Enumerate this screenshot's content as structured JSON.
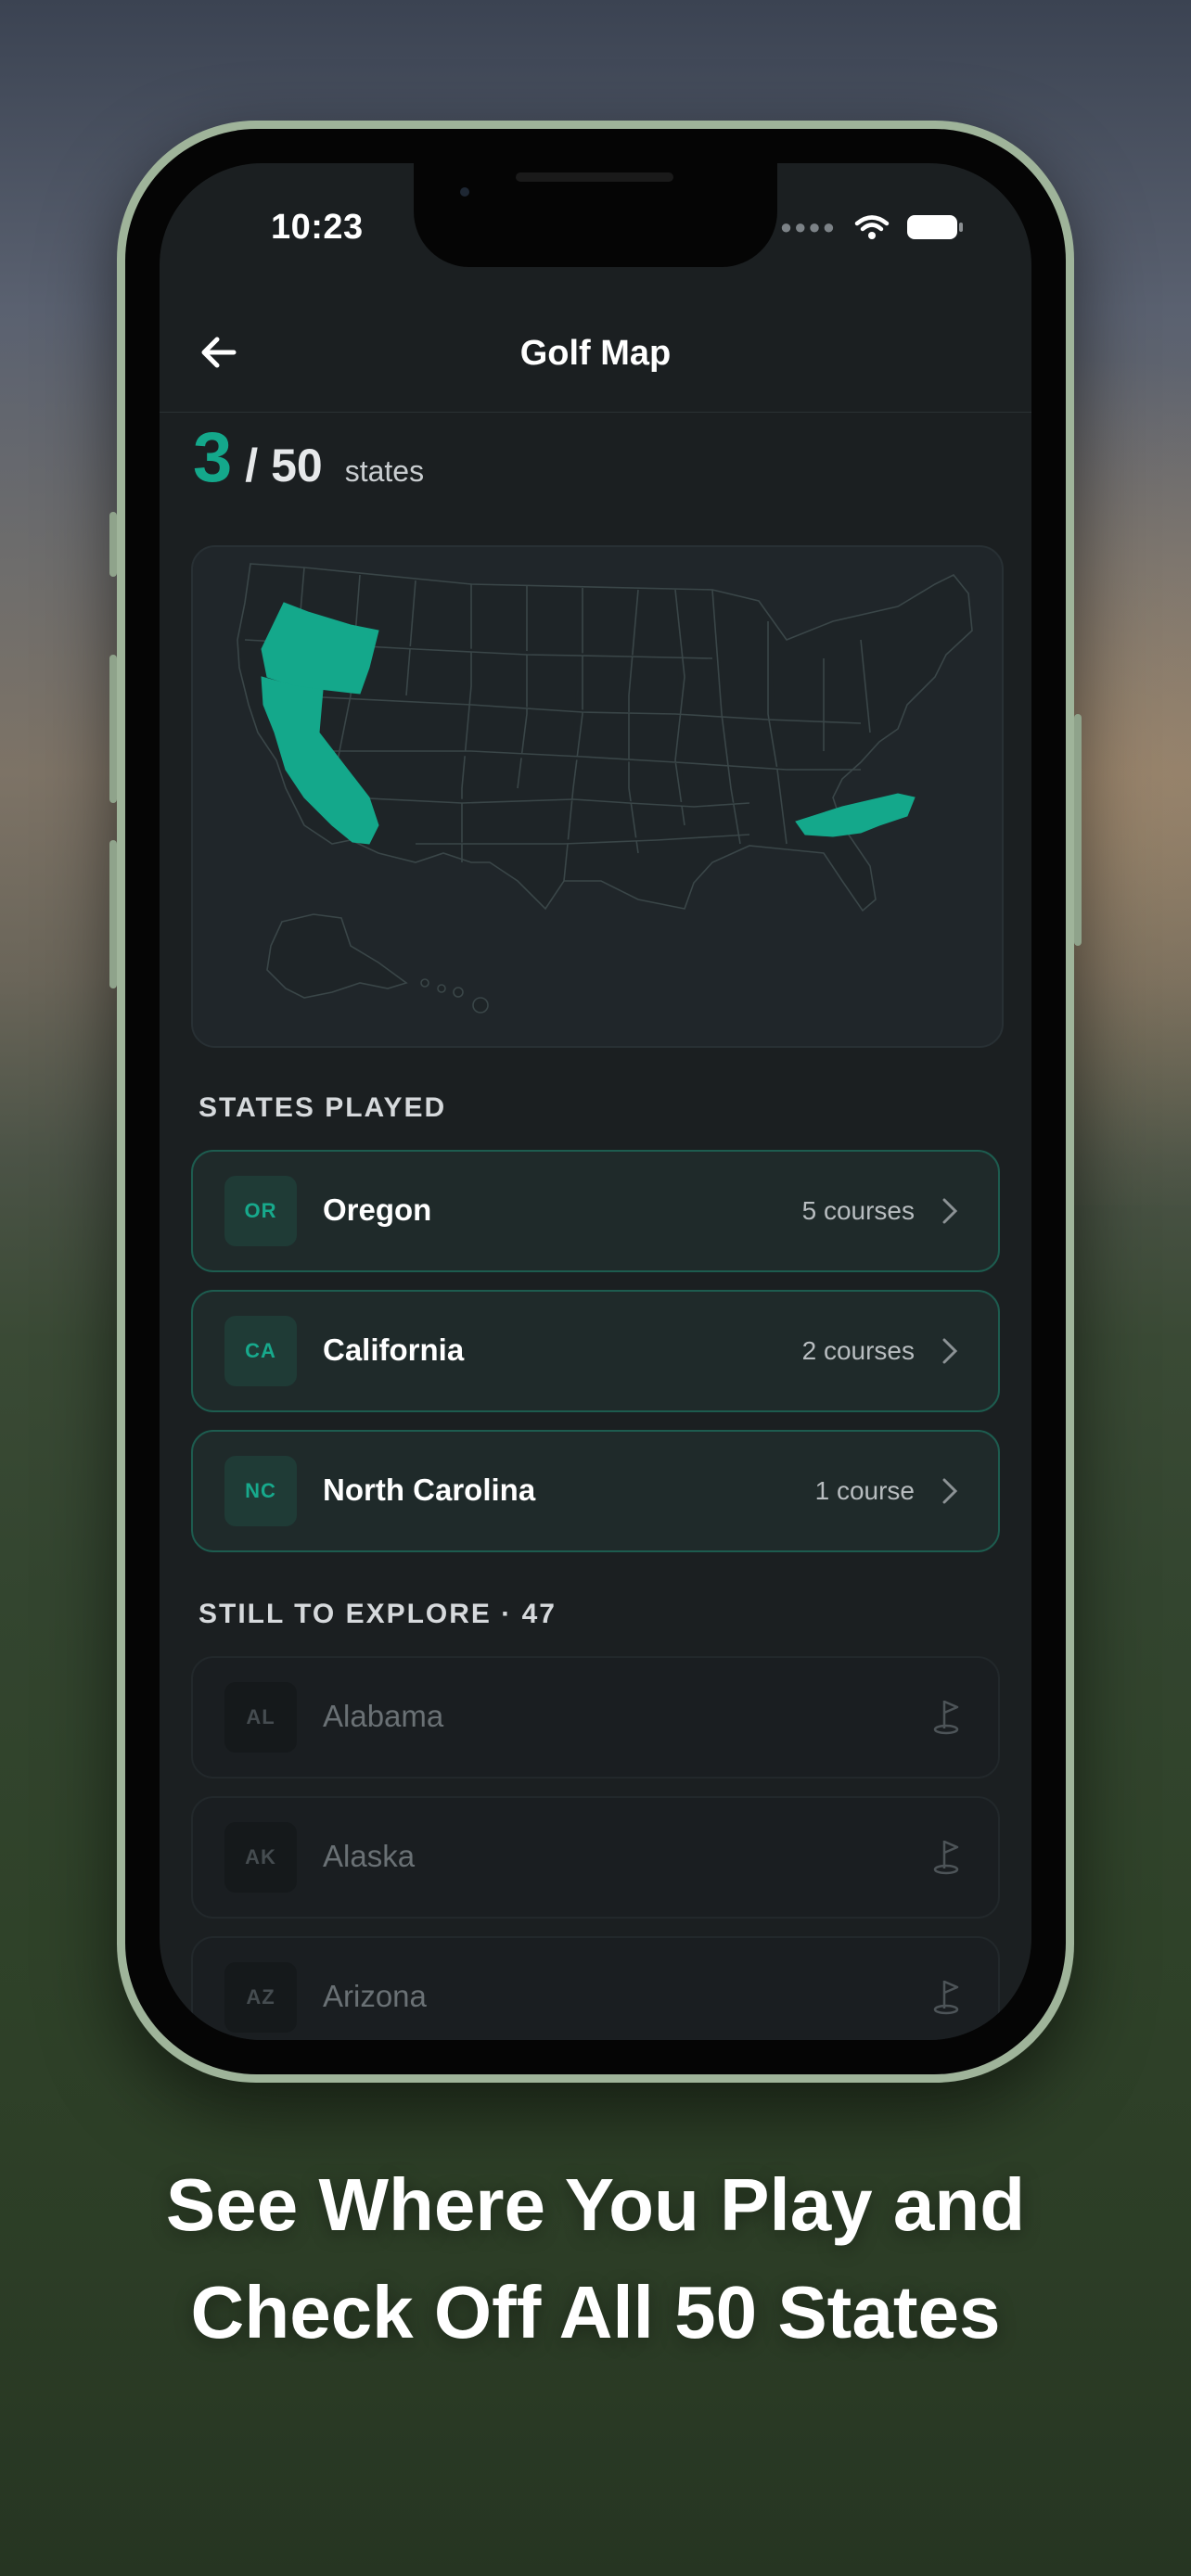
{
  "status_bar": {
    "time": "10:23"
  },
  "nav": {
    "title": "Golf Map",
    "back_icon": "arrow-left-icon"
  },
  "progress": {
    "played": "3",
    "total": "/ 50",
    "unit": "states"
  },
  "map": {
    "highlight_color": "#14a88b",
    "base_color": "#1e2427",
    "border_color": "#3a4648",
    "played_states": [
      "OR",
      "CA",
      "NC"
    ]
  },
  "states_played": {
    "heading": "STATES PLAYED",
    "items": [
      {
        "abbr": "OR",
        "name": "Oregon",
        "count": "5 courses"
      },
      {
        "abbr": "CA",
        "name": "California",
        "count": "2 courses"
      },
      {
        "abbr": "NC",
        "name": "North Carolina",
        "count": "1 course"
      }
    ]
  },
  "to_explore": {
    "heading": "STILL TO EXPLORE · 47",
    "items": [
      {
        "abbr": "AL",
        "name": "Alabama"
      },
      {
        "abbr": "AK",
        "name": "Alaska"
      },
      {
        "abbr": "AZ",
        "name": "Arizona"
      }
    ]
  },
  "caption": {
    "line1": "See Where You Play and",
    "line2": "Check Off All 50 States"
  }
}
